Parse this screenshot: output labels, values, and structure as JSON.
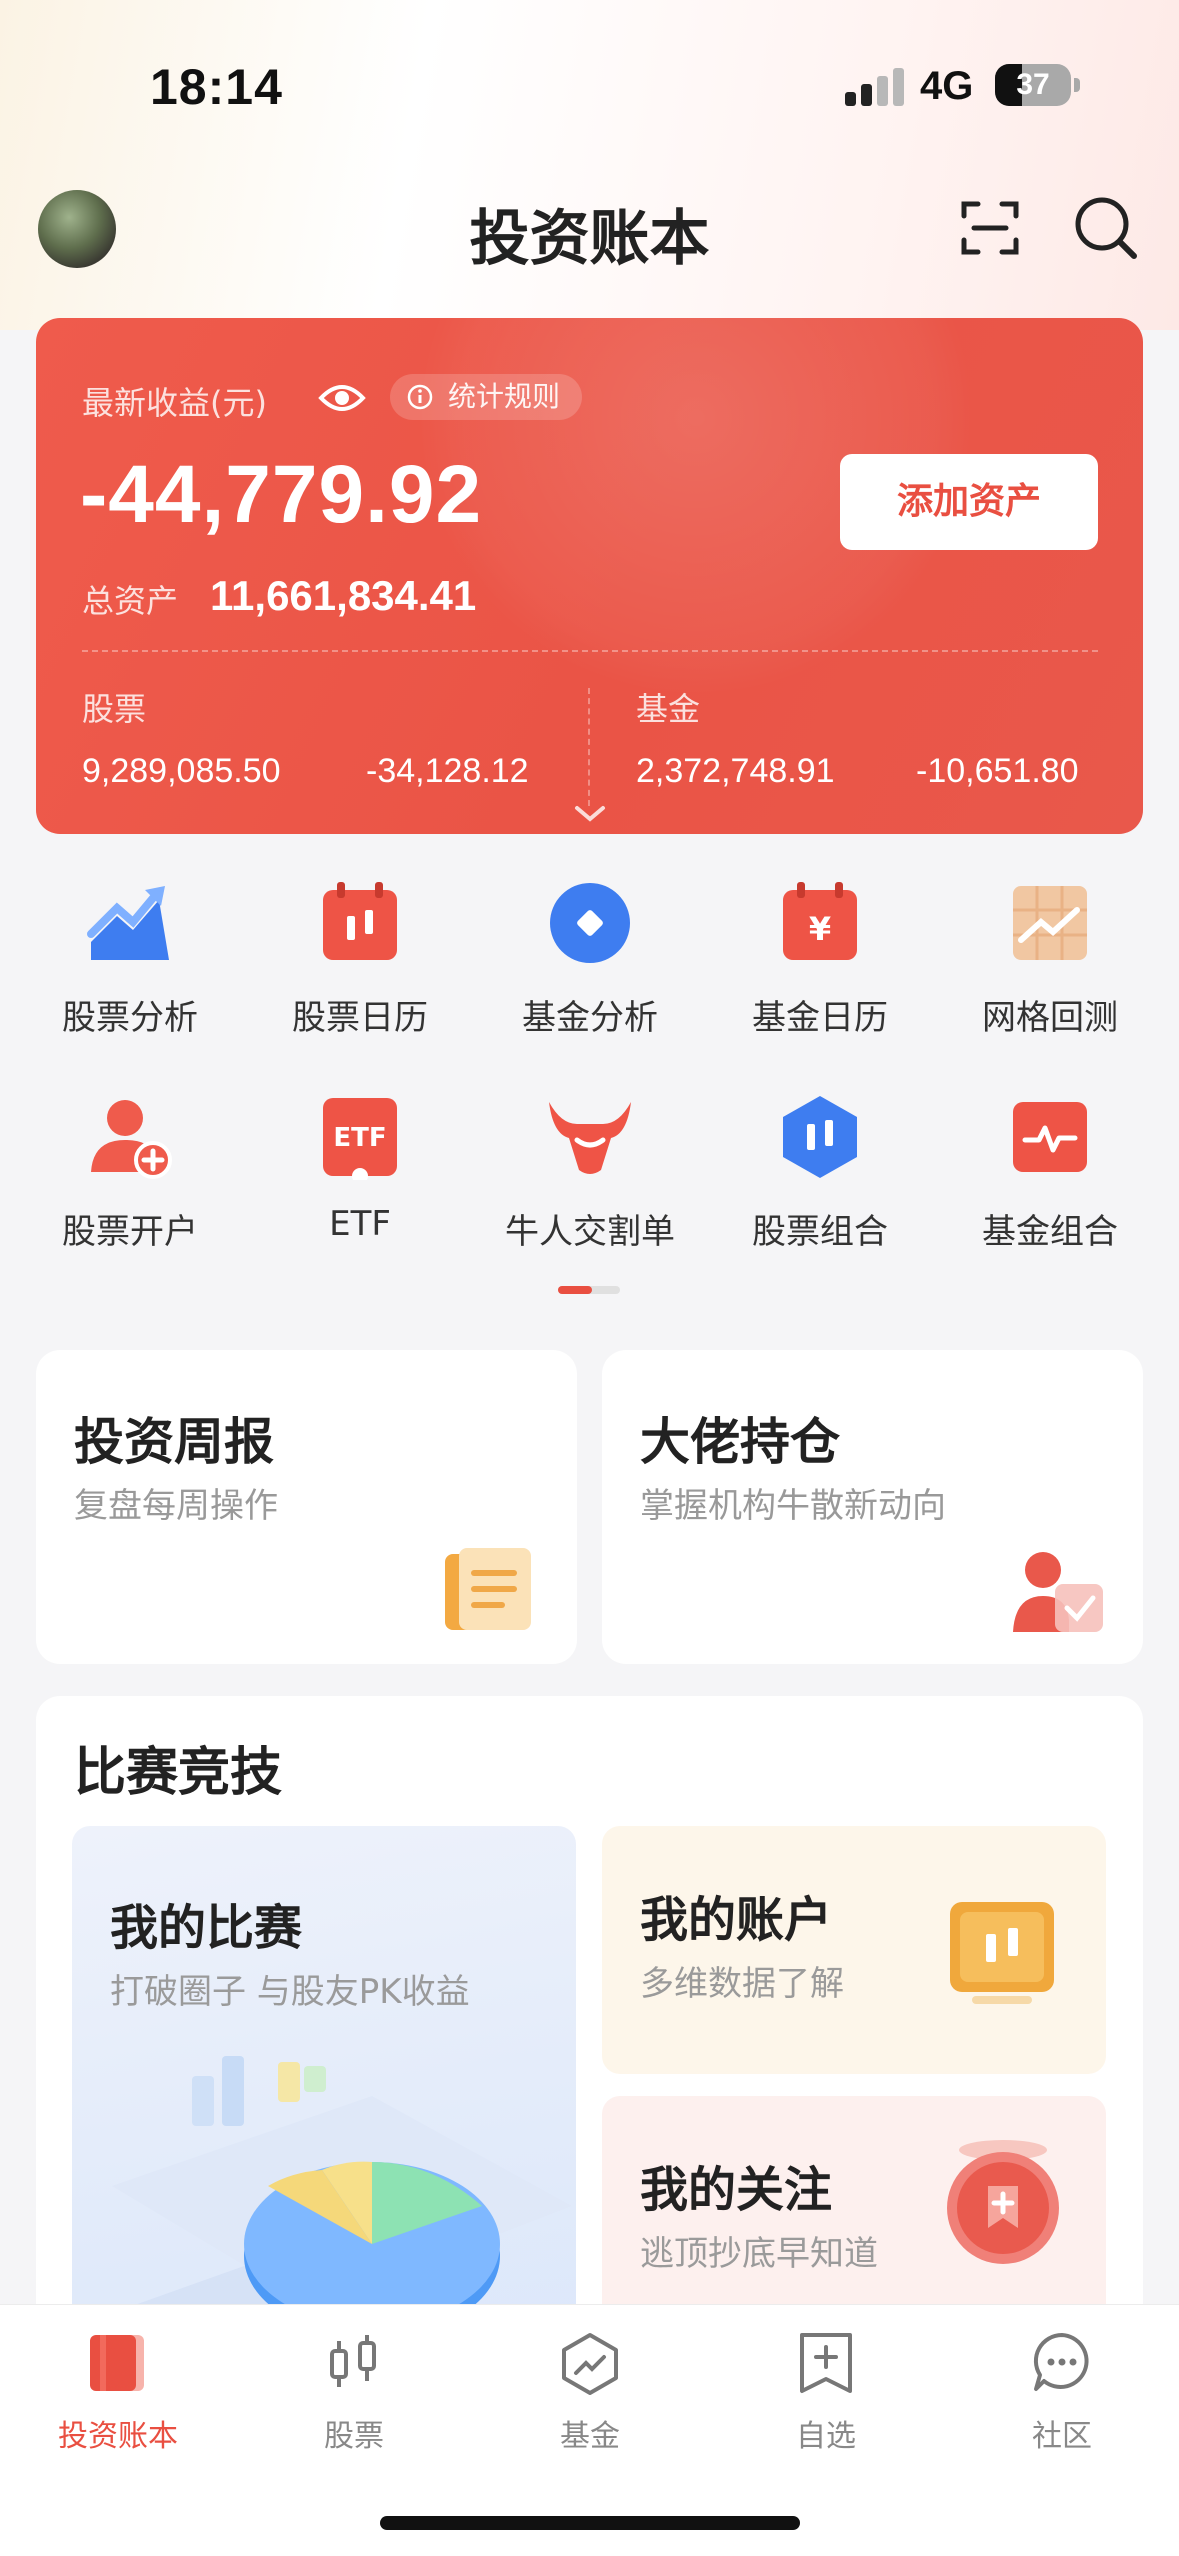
{
  "status_bar": {
    "time": "18:14",
    "network": "4G",
    "battery": "37"
  },
  "header": {
    "title": "投资账本"
  },
  "earnings": {
    "label": "最新收益(元)",
    "rule_chip": "统计规则",
    "value": "-44,779.92",
    "add_button": "添加资产",
    "total_label": "总资产",
    "total_value": "11,661,834.41",
    "stocks": {
      "label": "股票",
      "amount": "9,289,085.50",
      "pnl": "-34,128.12"
    },
    "funds": {
      "label": "基金",
      "amount": "2,372,748.91",
      "pnl": "-10,651.80"
    }
  },
  "grid": {
    "items": [
      {
        "label": "股票分析",
        "icon": "chart-trend-icon"
      },
      {
        "label": "股票日历",
        "icon": "stock-calendar-icon"
      },
      {
        "label": "基金分析",
        "icon": "fund-analysis-icon"
      },
      {
        "label": "基金日历",
        "icon": "fund-calendar-icon"
      },
      {
        "label": "网格回测",
        "icon": "grid-backtest-icon"
      },
      {
        "label": "股票开户",
        "icon": "open-account-icon"
      },
      {
        "label": "ETF",
        "icon": "etf-icon"
      },
      {
        "label": "牛人交割单",
        "icon": "bull-icon"
      },
      {
        "label": "股票组合",
        "icon": "stock-portfolio-icon"
      },
      {
        "label": "基金组合",
        "icon": "fund-portfolio-icon"
      }
    ]
  },
  "cards": {
    "weekly": {
      "title": "投资周报",
      "subtitle": "复盘每周操作"
    },
    "holdings": {
      "title": "大佬持仓",
      "subtitle": "掌握机构牛散新动向"
    }
  },
  "competition": {
    "title": "比赛竞技",
    "my_match": {
      "title": "我的比赛",
      "subtitle": "打破圈子 与股友PK收益"
    },
    "my_account": {
      "title": "我的账户",
      "subtitle": "多维数据了解"
    },
    "my_follow": {
      "title": "我的关注",
      "subtitle": "逃顶抄底早知道"
    }
  },
  "tabs": [
    {
      "label": "投资账本",
      "icon": "ledger-icon",
      "active": true
    },
    {
      "label": "股票",
      "icon": "candlestick-icon"
    },
    {
      "label": "基金",
      "icon": "fund-icon"
    },
    {
      "label": "自选",
      "icon": "watchlist-icon"
    },
    {
      "label": "社区",
      "icon": "community-icon"
    }
  ],
  "colors": {
    "accent": "#e94f41",
    "card_red": "#ea5446",
    "background": "#f5f5f7"
  }
}
